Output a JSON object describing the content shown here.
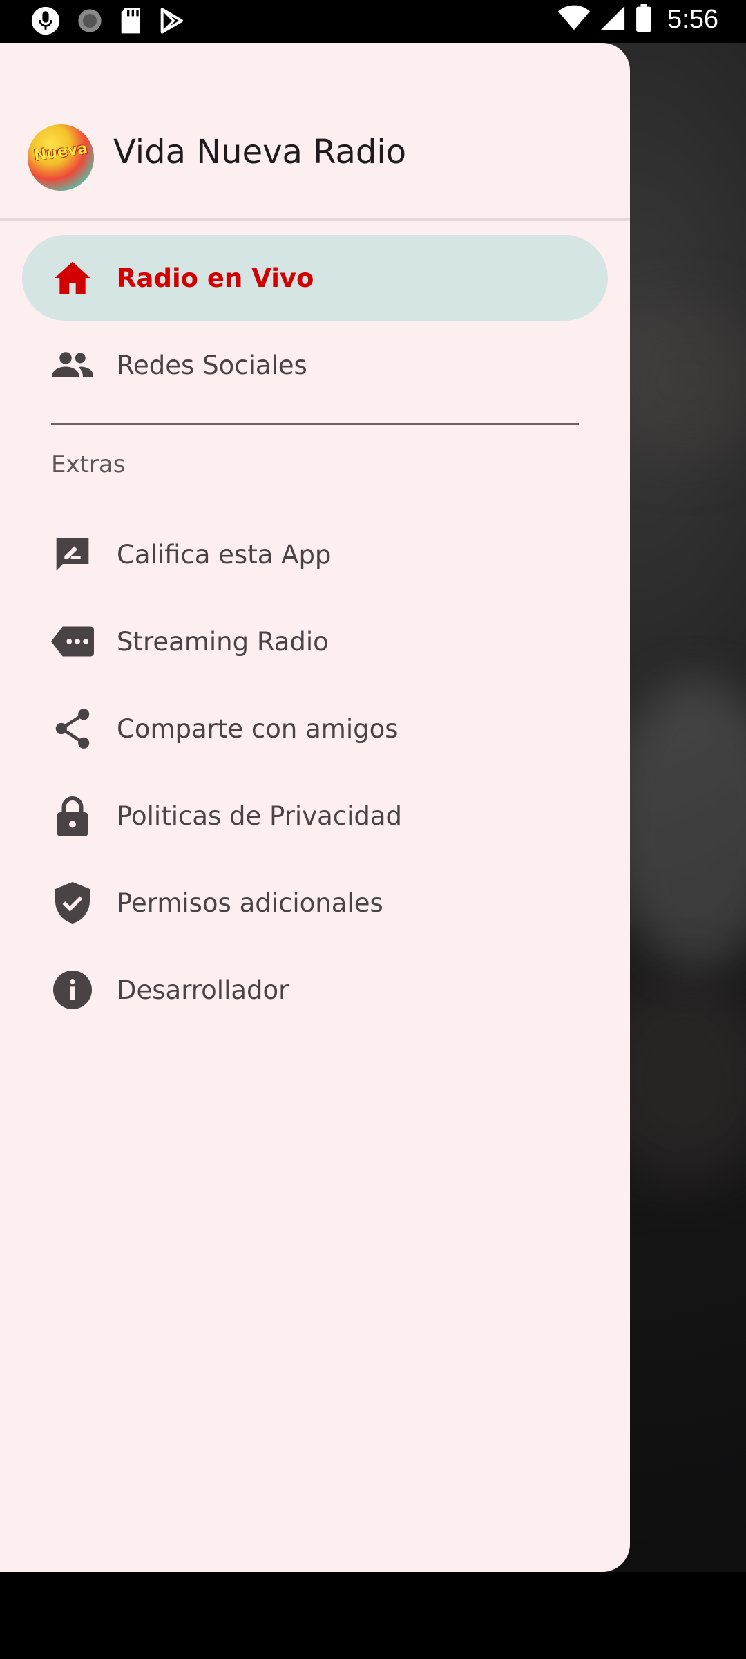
{
  "status_bar": {
    "time": "5:56",
    "left_icons": [
      "mic-icon",
      "loading-icon",
      "sd-card-icon",
      "play-store-icon"
    ],
    "right_icons": [
      "wifi-icon",
      "signal-icon",
      "battery-icon"
    ]
  },
  "drawer": {
    "header": {
      "logo_text": "Nueva",
      "title": "Vida Nueva Radio"
    },
    "primary_items": [
      {
        "label": "Radio en Vivo",
        "icon": "home-icon",
        "active": true
      },
      {
        "label": "Redes Sociales",
        "icon": "people-icon",
        "active": false
      }
    ],
    "section_label": "Extras",
    "extra_items": [
      {
        "label": "Califica esta App",
        "icon": "rate-review-icon"
      },
      {
        "label": "Streaming Radio",
        "icon": "more-tag-icon"
      },
      {
        "label": "Comparte con amigos",
        "icon": "share-icon"
      },
      {
        "label": "Politicas de Privacidad",
        "icon": "lock-icon"
      },
      {
        "label": "Permisos adicionales",
        "icon": "verified-shield-icon"
      },
      {
        "label": "Desarrollador",
        "icon": "info-icon"
      }
    ]
  },
  "colors": {
    "drawer_bg": "#fdeef0",
    "active_bg": "#d5e5e4",
    "active_text": "#d20000",
    "icon_color": "#4a4345"
  }
}
